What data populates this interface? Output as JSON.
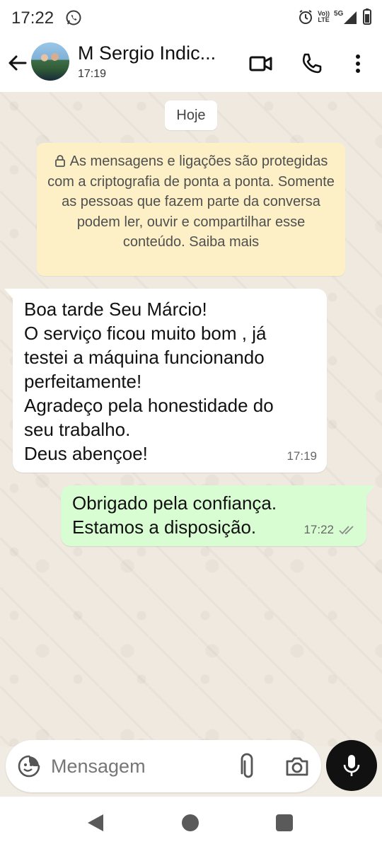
{
  "status_bar": {
    "time": "17:22",
    "network_top": "Vo))",
    "network_bottom": "LTE",
    "signal_label": "5G"
  },
  "header": {
    "contact_name": "M Sergio Indic...",
    "subtitle": "17:19"
  },
  "chat": {
    "date_chip": "Hoje",
    "encryption_notice": "As mensagens e ligações são protegidas com a criptografia de ponta a ponta. Somente as pessoas que fazem parte da conversa podem ler, ouvir e compartilhar esse conteúdo. Saiba mais",
    "messages": [
      {
        "direction": "incoming",
        "lines": [
          "Boa tarde Seu Márcio!",
          "O serviço ficou muito bom , já",
          "testei a máquina funcionando",
          "perfeitamente!",
          "Agradeço pela honestidade do",
          "seu trabalho.",
          "Deus abençoe!"
        ],
        "time": "17:19"
      },
      {
        "direction": "outgoing",
        "lines": [
          "Obrigado pela confiança.",
          "Estamos a disposição."
        ],
        "time": "17:22",
        "status": "read-double-check"
      }
    ]
  },
  "composer": {
    "placeholder": "Mensagem"
  },
  "icons": {
    "back": "arrow-left-icon",
    "video": "video-camera-icon",
    "call": "phone-icon",
    "menu": "more-vertical-icon",
    "emoji": "emoji-sticker-icon",
    "attach": "paperclip-icon",
    "camera": "camera-icon",
    "mic": "microphone-icon"
  },
  "colors": {
    "incoming_bubble": "#ffffff",
    "outgoing_bubble": "#d9fdd3",
    "notice_bg": "#fdf0c6",
    "chat_bg": "#efe9e0",
    "mic_button": "#111111"
  }
}
